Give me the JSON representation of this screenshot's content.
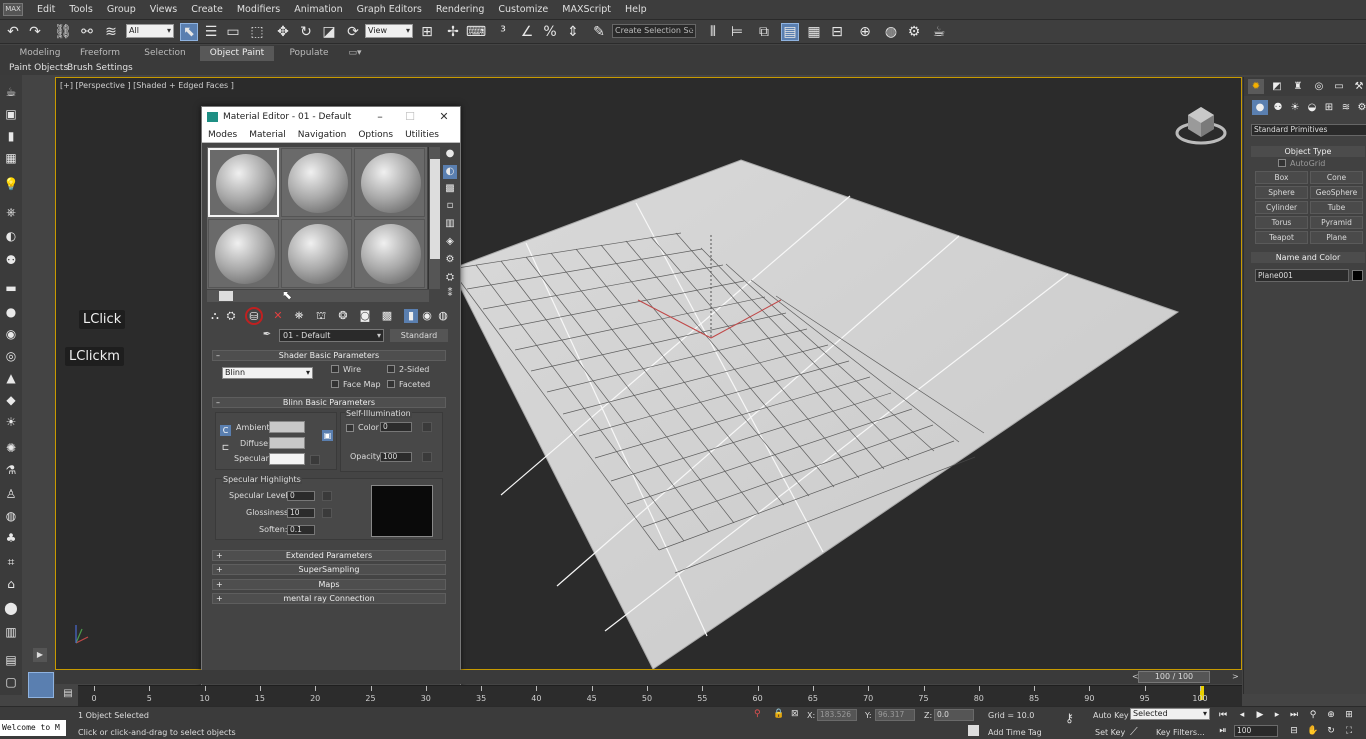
{
  "menubar": {
    "logo": "MAX",
    "items": [
      "Edit",
      "Tools",
      "Group",
      "Views",
      "Create",
      "Modifiers",
      "Animation",
      "Graph Editors",
      "Rendering",
      "Customize",
      "MAXScript",
      "Help"
    ]
  },
  "toolbar": {
    "selection_filter": "All",
    "reference_coord": "View",
    "named_selection": "Create Selection Se"
  },
  "ribbon": {
    "tabs": [
      "Modeling",
      "Freeform",
      "Selection",
      "Object Paint",
      "Populate"
    ],
    "active_tab": "Object Paint",
    "subitems": [
      "Paint Objects",
      "Brush Settings"
    ]
  },
  "viewport": {
    "label": "[+] [Perspective ] [Shaded + Edged Faces ]"
  },
  "overlays": {
    "click1": "LClick",
    "click2": "LClickm"
  },
  "material_editor": {
    "title": "Material Editor - 01 - Default",
    "menu": [
      "Modes",
      "Material",
      "Navigation",
      "Options",
      "Utilities"
    ],
    "material_name": "01 - Default",
    "material_type": "Standard",
    "shader_section": "Shader Basic Parameters",
    "shader_type": "Blinn",
    "shader_options": [
      "Wire",
      "2-Sided",
      "Face Map",
      "Faceted"
    ],
    "blinn_section": "Blinn Basic Parameters",
    "self_illumination": "Self-Illumination",
    "ambient_label": "Ambient:",
    "diffuse_label": "Diffuse:",
    "specular_label": "Specular:",
    "color_label": "Color",
    "color_value": "0",
    "opacity_label": "Opacity:",
    "opacity_value": "100",
    "specular_highlights": "Specular Highlights",
    "specular_level_label": "Specular Level:",
    "specular_level_value": "0",
    "glossiness_label": "Glossiness:",
    "glossiness_value": "10",
    "soften_label": "Soften:",
    "soften_value": "0.1",
    "collapsed_rollouts": [
      "Extended Parameters",
      "SuperSampling",
      "Maps",
      "mental ray Connection"
    ]
  },
  "command_panel": {
    "category": "Standard Primitives",
    "object_type_header": "Object Type",
    "autogrid": "AutoGrid",
    "buttons": [
      "Box",
      "Cone",
      "Sphere",
      "GeoSphere",
      "Cylinder",
      "Tube",
      "Torus",
      "Pyramid",
      "Teapot",
      "Plane"
    ],
    "name_color_header": "Name and Color",
    "object_name": "Plane001",
    "object_color": "#000000"
  },
  "timeline": {
    "frame_display": "100 / 100",
    "ruler_marks": [
      "0",
      "5",
      "10",
      "15",
      "20",
      "25",
      "30",
      "35",
      "40",
      "45",
      "50",
      "55",
      "60",
      "65",
      "70",
      "75",
      "80",
      "85",
      "90",
      "95",
      "100"
    ]
  },
  "status": {
    "selection": "1 Object Selected",
    "prompt": "Click or click-and-drag to select objects",
    "welcome": "Welcome to M",
    "x_label": "X:",
    "x_value": "183.526",
    "y_label": "Y:",
    "y_value": "96.317",
    "z_label": "Z:",
    "z_value": "0.0",
    "grid": "Grid = 10.0",
    "auto_key": "Auto Key",
    "set_key": "Set Key",
    "key_mode": "Selected",
    "key_filters": "Key Filters...",
    "add_time_tag": "Add Time Tag",
    "current_frame": "100"
  },
  "colors": {
    "viewport_border": "#c79a00",
    "active_accent": "#5a7fb0",
    "highlight_ring": "#c02020"
  }
}
